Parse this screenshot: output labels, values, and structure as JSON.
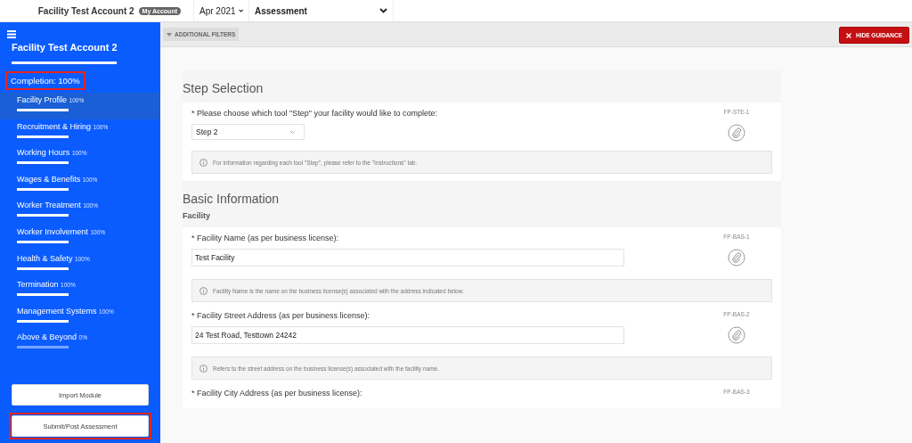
{
  "top_bar": {
    "account_name": "Facility Test Account 2",
    "account_badge": "My Account",
    "period": "Apr 2021",
    "view": "Assessment"
  },
  "sidebar": {
    "title": "Facility Test Account 2",
    "completion": {
      "label": "Completion: 100%",
      "highlighted": true
    },
    "items": [
      {
        "name": "Facility Profile",
        "percent": "100%",
        "level": 1,
        "selected": true
      },
      {
        "name": "Recruitment & Hiring",
        "percent": "100%",
        "level": 1,
        "selected": false
      },
      {
        "name": "Working Hours",
        "percent": "100%",
        "level": 1,
        "selected": false
      },
      {
        "name": "Wages & Benefits",
        "percent": "100%",
        "level": 1,
        "selected": false
      },
      {
        "name": "Worker Treatment",
        "percent": "100%",
        "level": 1,
        "selected": false
      },
      {
        "name": "Worker Involvement",
        "percent": "100%",
        "level": 1,
        "selected": false
      },
      {
        "name": "Health & Safety",
        "percent": "100%",
        "level": 1,
        "selected": false
      },
      {
        "name": "Termination",
        "percent": "100%",
        "level": 1,
        "selected": false
      },
      {
        "name": "Management Systems",
        "percent": "100%",
        "level": 1,
        "selected": false
      },
      {
        "name": "Above & Beyond",
        "percent": "0%",
        "level": 0,
        "selected": false
      }
    ],
    "buttons": [
      {
        "label": "Import Module",
        "highlighted": false
      },
      {
        "label": "Submit/Post Assessment",
        "highlighted": true
      }
    ]
  },
  "filters": {
    "label": "ADDITIONAL FILTERS",
    "hide_button": "HIDE GUIDANCE"
  },
  "sections": [
    {
      "title": "Step Selection",
      "questions": [
        {
          "kind": "select",
          "label": "* Please choose which tool \"Step\" your facility would like to complete:",
          "code": "FP-STE-1",
          "value": "Step 2",
          "hint": "For information regarding each tool \"Step\", please refer to the \"Instructions\" tab."
        }
      ]
    },
    {
      "title": "Basic Information",
      "subtitle": "Facility",
      "questions": [
        {
          "kind": "text",
          "label": "* Facility Name (as per business license):",
          "code": "FP-BAS-1",
          "value": "Test Facility",
          "hint": "Facility Name is the name on the business license(s) associated with the address indicated below."
        },
        {
          "kind": "text",
          "label": "* Facility Street Address (as per business license):",
          "code": "FP-BAS-2",
          "value": "24 Test Road, Testtown 24242",
          "hint": "Refers to the street address on the business license(s) associated with the facility name."
        },
        {
          "kind": "label_only",
          "label": "* Facility City Address (as per business license):",
          "code": "FP-BAS-3"
        }
      ]
    }
  ]
}
